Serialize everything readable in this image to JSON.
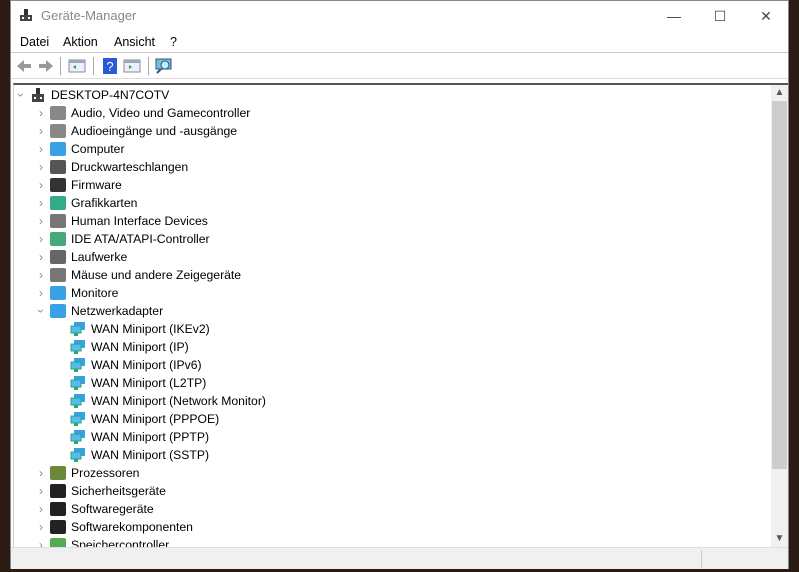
{
  "window": {
    "title": "Geräte-Manager",
    "minimize": "—",
    "maximize": "☐",
    "close": "✕"
  },
  "menu": [
    "Datei",
    "Aktion",
    "Ansicht",
    "?"
  ],
  "toolbar": [
    "back-icon",
    "forward-icon",
    "show-hide-console-tree-icon",
    "help-icon",
    "properties-icon",
    "scan-hardware-icon"
  ],
  "tree": {
    "root": "DESKTOP-4N7COTV",
    "categories": [
      {
        "label": "Audio, Video und Gamecontroller",
        "icon": "speaker-icon"
      },
      {
        "label": "Audioeingänge und -ausgänge",
        "icon": "speaker-icon"
      },
      {
        "label": "Computer",
        "icon": "monitor-icon"
      },
      {
        "label": "Druckwarteschlangen",
        "icon": "printer-icon"
      },
      {
        "label": "Firmware",
        "icon": "chip-icon"
      },
      {
        "label": "Grafikkarten",
        "icon": "display-adapter-icon"
      },
      {
        "label": "Human Interface Devices",
        "icon": "hid-icon"
      },
      {
        "label": "IDE ATA/ATAPI-Controller",
        "icon": "controller-icon"
      },
      {
        "label": "Laufwerke",
        "icon": "drive-icon"
      },
      {
        "label": "Mäuse und andere Zeigegeräte",
        "icon": "mouse-icon"
      },
      {
        "label": "Monitore",
        "icon": "monitor-icon"
      },
      {
        "label": "Netzwerkadapter",
        "icon": "network-icon",
        "expanded": true,
        "children": [
          "WAN Miniport (IKEv2)",
          "WAN Miniport (IP)",
          "WAN Miniport (IPv6)",
          "WAN Miniport (L2TP)",
          "WAN Miniport (Network Monitor)",
          "WAN Miniport (PPPOE)",
          "WAN Miniport (PPTP)",
          "WAN Miniport (SSTP)"
        ]
      },
      {
        "label": "Prozessoren",
        "icon": "processor-icon"
      },
      {
        "label": "Sicherheitsgeräte",
        "icon": "security-device-icon"
      },
      {
        "label": "Softwaregeräte",
        "icon": "software-device-icon"
      },
      {
        "label": "Softwarekomponenten",
        "icon": "software-component-icon"
      },
      {
        "label": "Speichercontroller",
        "icon": "storage-controller-icon"
      }
    ]
  }
}
